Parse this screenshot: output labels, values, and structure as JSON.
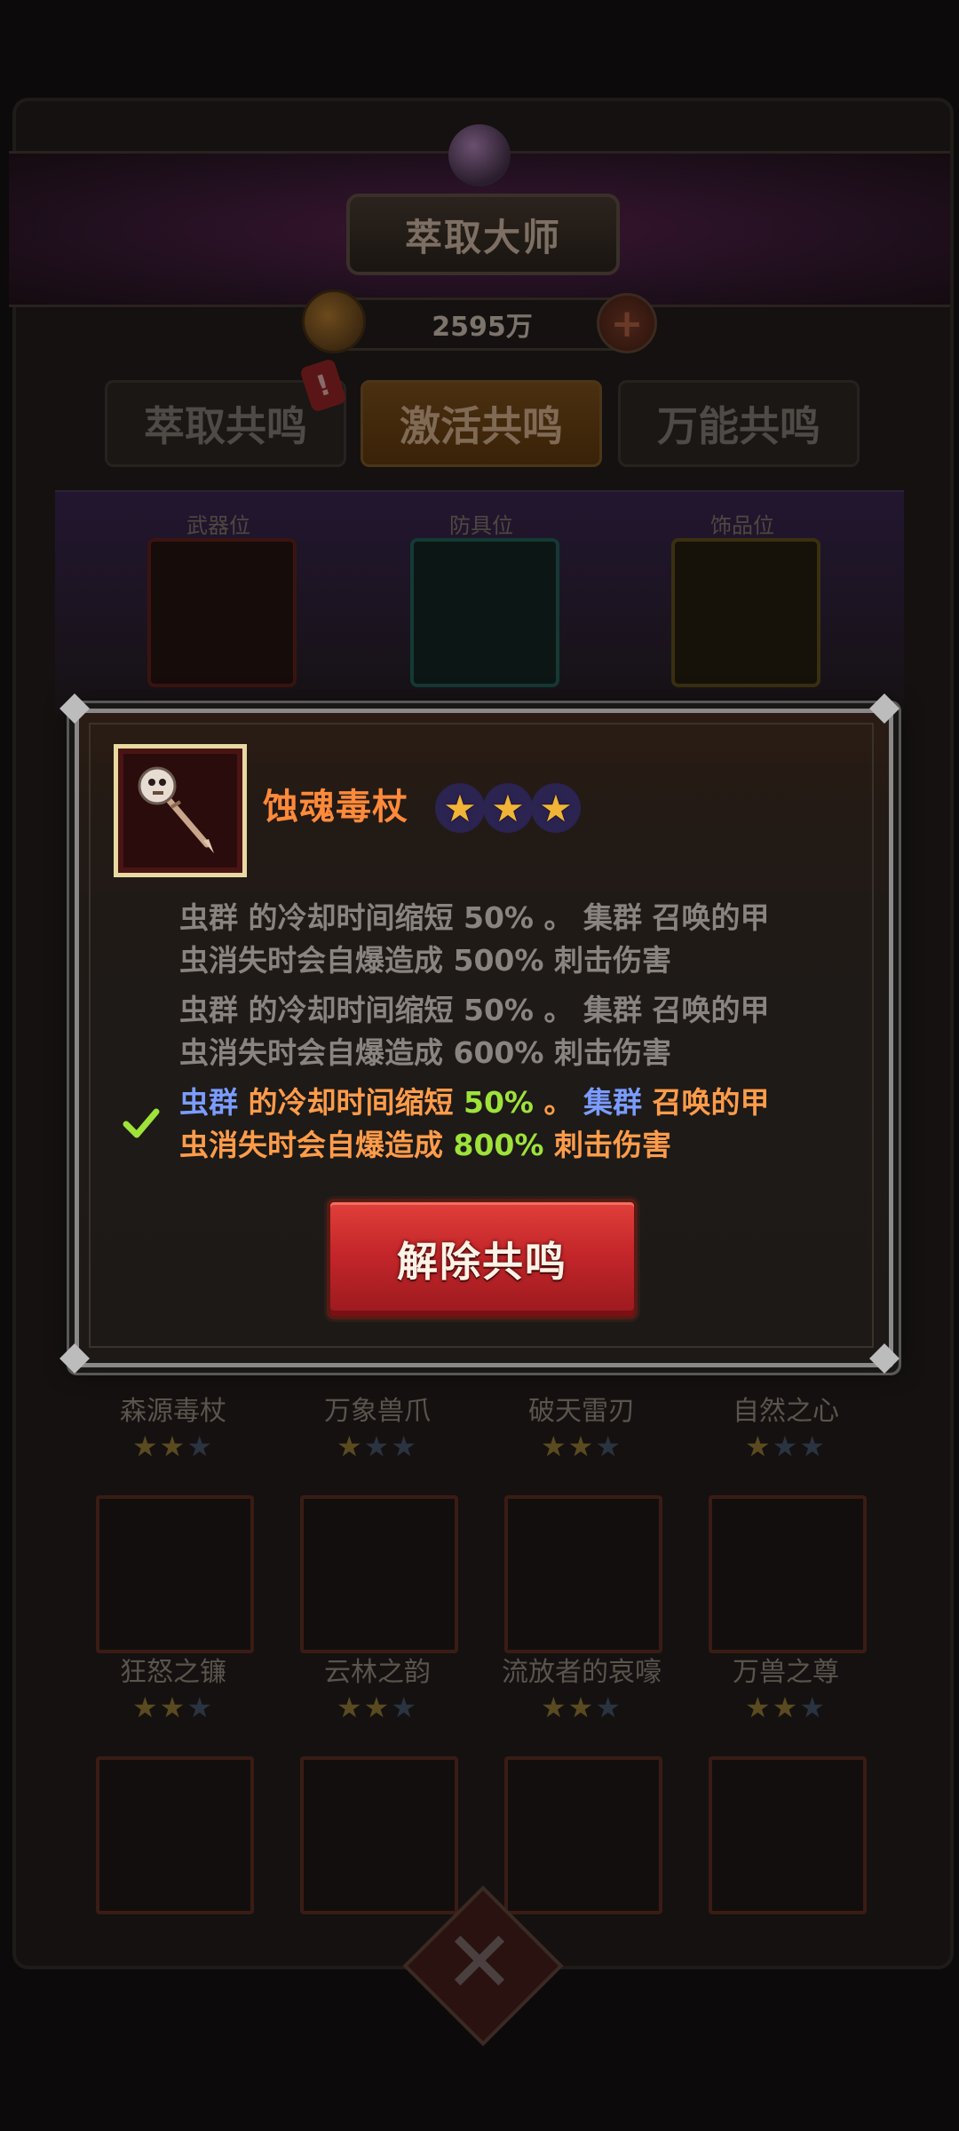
{
  "header": {
    "title": "萃取大师",
    "currency_amount": "2595万",
    "plus_symbol": "+",
    "alert_symbol": "!"
  },
  "tabs": [
    {
      "label": "萃取共鸣",
      "active": false
    },
    {
      "label": "激活共鸣",
      "active": true
    },
    {
      "label": "万能共鸣",
      "active": false
    }
  ],
  "slots": [
    {
      "caption": "武器位"
    },
    {
      "caption": "防具位"
    },
    {
      "caption": "饰品位"
    }
  ],
  "grid": {
    "row1": [
      {
        "name": "森源毒杖",
        "stars": 2
      },
      {
        "name": "万象兽爪",
        "stars": 1
      },
      {
        "name": "破天雷刃",
        "stars": 2
      },
      {
        "name": "自然之心",
        "stars": 1
      }
    ],
    "row2": [
      {
        "name": "狂怒之镰",
        "stars": 2
      },
      {
        "name": "云林之韵",
        "stars": 2
      },
      {
        "name": "流放者的哀嚎",
        "stars": 2
      },
      {
        "name": "万兽之尊",
        "stars": 2
      }
    ]
  },
  "modal": {
    "item_name": "蚀魂毒杖",
    "item_stars": 3,
    "star_glyph": "★",
    "check_glyph": "✔",
    "effects": [
      {
        "line1": {
          "a": "虫群",
          "b": " 的冷却时间缩短 ",
          "c": "50%",
          "d": " 。 ",
          "e": "集群",
          "f": " 召唤的甲"
        },
        "line2": {
          "a": "虫消失时会自爆造成 ",
          "b": "500%",
          "c": " 刺击伤害"
        },
        "active": false
      },
      {
        "line1": {
          "a": "虫群",
          "b": " 的冷却时间缩短 ",
          "c": "50%",
          "d": " 。 ",
          "e": "集群",
          "f": " 召唤的甲"
        },
        "line2": {
          "a": "虫消失时会自爆造成 ",
          "b": "600%",
          "c": " 刺击伤害"
        },
        "active": false
      },
      {
        "line1": {
          "a": "虫群",
          "b": " 的冷却时间缩短 ",
          "c": "50%",
          "d": " 。 ",
          "e": "集群",
          "f": " 召唤的甲"
        },
        "line2": {
          "a": "虫消失时会自爆造成 ",
          "b": "800%",
          "c": " 刺击伤害"
        },
        "active": true
      }
    ],
    "button_label": "解除共鸣"
  },
  "colors": {
    "item_name": "#ff8a3a",
    "highlight_blue": "#7b9cff",
    "highlight_green": "#9ee23a",
    "active_text": "#ff9c4a",
    "dim_text": "#8a8480",
    "button_red": "#c4262a",
    "star_gold": "#f1b437"
  }
}
